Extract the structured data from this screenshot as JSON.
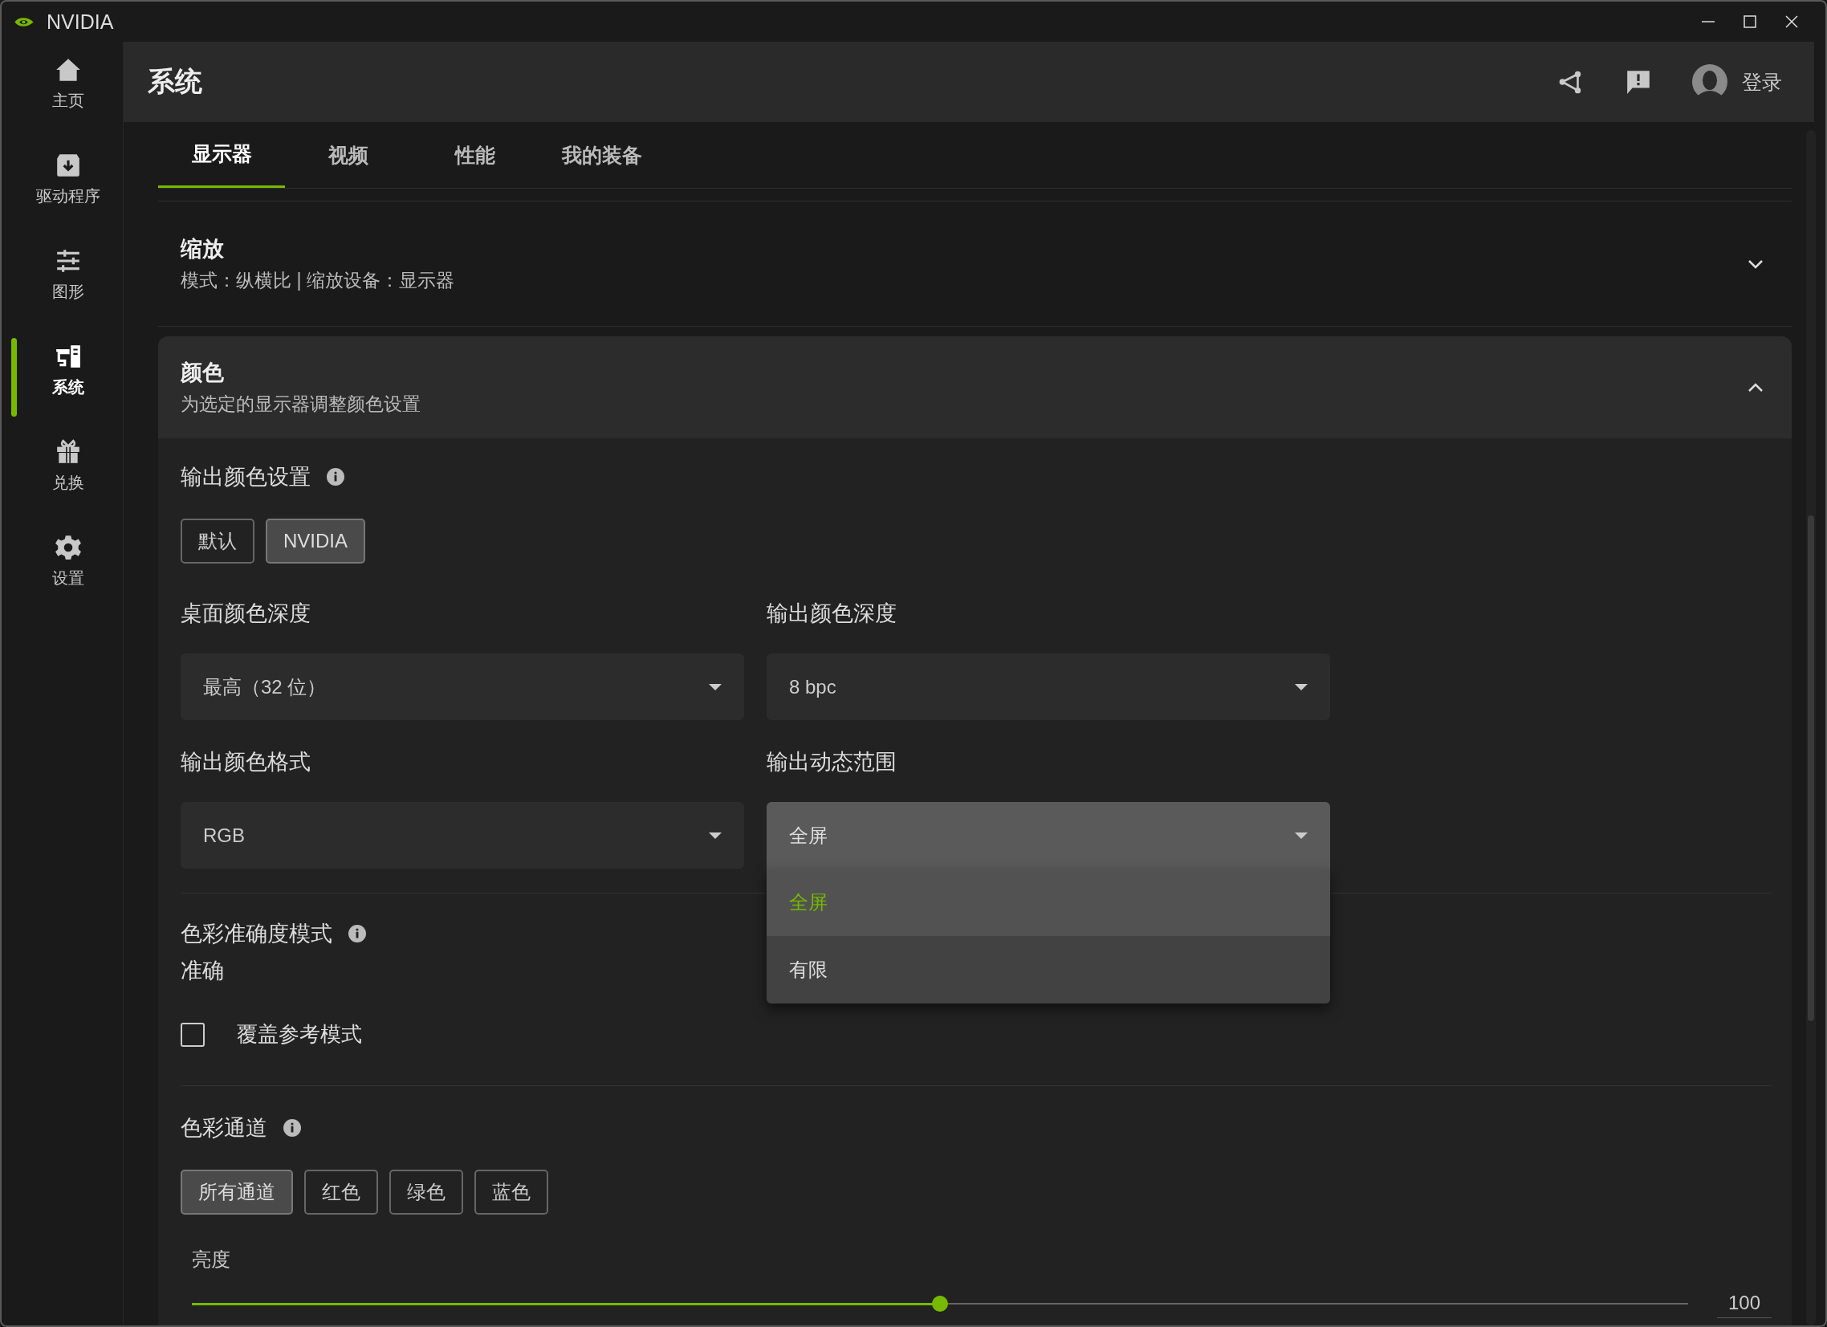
{
  "window": {
    "title": "NVIDIA"
  },
  "sidebar": {
    "items": [
      {
        "label": "主页",
        "selected": false
      },
      {
        "label": "驱动程序",
        "selected": false
      },
      {
        "label": "图形",
        "selected": false
      },
      {
        "label": "系统",
        "selected": true
      },
      {
        "label": "兑换",
        "selected": false
      },
      {
        "label": "设置",
        "selected": false
      }
    ]
  },
  "header": {
    "title": "系统",
    "login": "登录"
  },
  "tabs": [
    {
      "label": "显示器",
      "selected": true
    },
    {
      "label": "视频",
      "selected": false
    },
    {
      "label": "性能",
      "selected": false
    },
    {
      "label": "我的装备",
      "selected": false
    }
  ],
  "sections": [
    {
      "title": "缩放",
      "subtitle": "模式：纵横比 | 缩放设备：显示器",
      "expanded": false
    },
    {
      "title": "颜色",
      "subtitle": "为选定的显示器调整颜色设置",
      "expanded": true
    }
  ],
  "color": {
    "output_color_setting": {
      "label": "输出颜色设置",
      "options": [
        {
          "label": "默认",
          "selected": false
        },
        {
          "label": "NVIDIA",
          "selected": true
        }
      ]
    },
    "dropdowns": [
      {
        "label": "桌面颜色深度",
        "value": "最高（32 位）",
        "expanded": false
      },
      {
        "label": "输出颜色深度",
        "value": "8 bpc",
        "expanded": false
      },
      {
        "label": "输出颜色格式",
        "value": "RGB",
        "expanded": false
      },
      {
        "label": "输出动态范围",
        "value": "全屏",
        "expanded": true,
        "options": [
          {
            "label": "全屏",
            "selected": true
          },
          {
            "label": "有限",
            "selected": false
          }
        ]
      }
    ],
    "accuracy": {
      "label": "色彩准确度模式",
      "value": "准确",
      "override": {
        "label": "覆盖参考模式",
        "checked": false
      }
    },
    "channels": {
      "label": "色彩通道",
      "options": [
        {
          "label": "所有通道",
          "selected": true
        },
        {
          "label": "红色",
          "selected": false
        },
        {
          "label": "绿色",
          "selected": false
        },
        {
          "label": "蓝色",
          "selected": false
        }
      ]
    },
    "brightness": {
      "label": "亮度",
      "level": 0.5,
      "reading": "100"
    }
  }
}
